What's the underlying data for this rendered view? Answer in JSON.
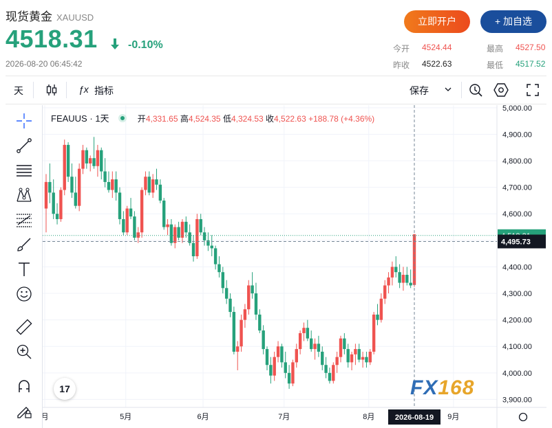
{
  "header": {
    "name": "现货黄金",
    "symbol": "XAUUSD",
    "price": "4518.31",
    "change_pct": "-0.10%",
    "timestamp": "2026-08-20 06:45:42",
    "open_account_label": "立即开户",
    "watchlist_label": "+ 加自选",
    "stats": {
      "open_label": "今开",
      "open_value": "4524.44",
      "high_label": "最高",
      "high_value": "4527.50",
      "prev_close_label": "昨收",
      "prev_close_value": "4522.63",
      "low_label": "最低",
      "low_value": "4517.52"
    },
    "colors": {
      "up": "#ef5350",
      "down": "#26a17b",
      "price_text": "#26a17b"
    }
  },
  "toolbar": {
    "interval_label": "天",
    "indicators_label": "指标",
    "save_label": "保存",
    "icons": [
      "candle-style-icon",
      "fx-indicator-icon",
      "chevron-down-icon",
      "alert-icon",
      "settings-hexagon-icon",
      "fullscreen-icon"
    ]
  },
  "left_tools": [
    "crosshair-icon",
    "trend-line-icon",
    "horizontal-lines-icon",
    "pattern-icon",
    "fib-levels-icon",
    "brush-icon",
    "text-icon",
    "emoji-icon",
    "ruler-icon",
    "zoom-icon",
    "magnet-icon",
    "lock-pencil-icon"
  ],
  "legend": {
    "symbol": "FEAUUS",
    "interval": "1天",
    "open_label": "开",
    "open": "4,331.65",
    "high_label": "高",
    "high": "4,524.35",
    "low_label": "低",
    "low": "4,324.53",
    "close_label": "收",
    "close": "4,522.63",
    "change": "+188.78 (+4.36%)"
  },
  "watermark": {
    "fx": "FX",
    "num": "168"
  },
  "tv_logo": "17",
  "chart_data": {
    "type": "candlestick",
    "y_ticks": [
      "5,000.00",
      "4,900.00",
      "4,800.00",
      "4,700.00",
      "4,600.00",
      "4,500.00",
      "4,400.00",
      "4,300.00",
      "4,200.00",
      "4,100.00",
      "4,000.00",
      "3,900.00"
    ],
    "ylim": [
      3870,
      5010
    ],
    "x_labels": [
      {
        "label": "月",
        "index": 0
      },
      {
        "label": "5月",
        "index": 22
      },
      {
        "label": "6月",
        "index": 43
      },
      {
        "label": "7月",
        "index": 65
      },
      {
        "label": "8月",
        "index": 88
      },
      {
        "label": "9月",
        "index": 111
      }
    ],
    "crosshair": {
      "date_label": "2026-08-19",
      "index": 100,
      "price": 4495.73,
      "price_label": "4,495.73"
    },
    "last_price": {
      "value": 4518.31,
      "label": "4,518.31"
    },
    "grid": true,
    "colors": {
      "up": "#ef5350",
      "down": "#26a17b"
    },
    "candles": [
      [
        4620,
        4750,
        4530,
        4720
      ],
      [
        4720,
        4790,
        4640,
        4680
      ],
      [
        4680,
        4730,
        4580,
        4600
      ],
      [
        4600,
        4640,
        4560,
        4580
      ],
      [
        4580,
        4700,
        4570,
        4690
      ],
      [
        4690,
        4880,
        4670,
        4860
      ],
      [
        4860,
        4870,
        4720,
        4740
      ],
      [
        4740,
        4790,
        4660,
        4680
      ],
      [
        4680,
        4740,
        4620,
        4630
      ],
      [
        4630,
        4790,
        4610,
        4770
      ],
      [
        4770,
        4860,
        4750,
        4840
      ],
      [
        4840,
        4850,
        4770,
        4790
      ],
      [
        4790,
        4820,
        4760,
        4810
      ],
      [
        4810,
        4890,
        4770,
        4780
      ],
      [
        4780,
        4860,
        4740,
        4840
      ],
      [
        4840,
        4850,
        4730,
        4760
      ],
      [
        4760,
        4810,
        4700,
        4720
      ],
      [
        4720,
        4760,
        4680,
        4690
      ],
      [
        4690,
        4760,
        4660,
        4730
      ],
      [
        4730,
        4760,
        4650,
        4680
      ],
      [
        4680,
        4700,
        4560,
        4580
      ],
      [
        4580,
        4610,
        4520,
        4530
      ],
      [
        4530,
        4630,
        4520,
        4620
      ],
      [
        4620,
        4660,
        4580,
        4590
      ],
      [
        4590,
        4610,
        4500,
        4510
      ],
      [
        4510,
        4550,
        4490,
        4530
      ],
      [
        4530,
        4700,
        4510,
        4690
      ],
      [
        4690,
        4760,
        4670,
        4740
      ],
      [
        4740,
        4760,
        4670,
        4680
      ],
      [
        4680,
        4750,
        4660,
        4730
      ],
      [
        4730,
        4770,
        4690,
        4710
      ],
      [
        4710,
        4730,
        4640,
        4650
      ],
      [
        4650,
        4660,
        4540,
        4550
      ],
      [
        4550,
        4580,
        4520,
        4560
      ],
      [
        4560,
        4580,
        4480,
        4490
      ],
      [
        4490,
        4560,
        4470,
        4550
      ],
      [
        4550,
        4570,
        4500,
        4510
      ],
      [
        4510,
        4580,
        4490,
        4570
      ],
      [
        4570,
        4590,
        4510,
        4530
      ],
      [
        4530,
        4560,
        4480,
        4490
      ],
      [
        4490,
        4520,
        4420,
        4440
      ],
      [
        4440,
        4600,
        4430,
        4580
      ],
      [
        4580,
        4600,
        4520,
        4530
      ],
      [
        4530,
        4550,
        4480,
        4500
      ],
      [
        4500,
        4530,
        4460,
        4480
      ],
      [
        4480,
        4520,
        4440,
        4470
      ],
      [
        4470,
        4480,
        4390,
        4410
      ],
      [
        4410,
        4440,
        4360,
        4380
      ],
      [
        4380,
        4400,
        4300,
        4320
      ],
      [
        4320,
        4350,
        4260,
        4280
      ],
      [
        4280,
        4300,
        4210,
        4230
      ],
      [
        4230,
        4250,
        4070,
        4080
      ],
      [
        4080,
        4120,
        4010,
        4100
      ],
      [
        4100,
        4220,
        4080,
        4200
      ],
      [
        4200,
        4260,
        4170,
        4240
      ],
      [
        4240,
        4350,
        4220,
        4330
      ],
      [
        4330,
        4380,
        4280,
        4300
      ],
      [
        4300,
        4340,
        4200,
        4220
      ],
      [
        4220,
        4240,
        4150,
        4160
      ],
      [
        4160,
        4180,
        4070,
        4090
      ],
      [
        4090,
        4100,
        4010,
        4030
      ],
      [
        4030,
        4060,
        3960,
        3990
      ],
      [
        3990,
        4080,
        3970,
        4060
      ],
      [
        4060,
        4120,
        4040,
        4100
      ],
      [
        4100,
        4110,
        4020,
        4040
      ],
      [
        4040,
        4080,
        3980,
        4000
      ],
      [
        4000,
        4030,
        3940,
        3960
      ],
      [
        3960,
        4050,
        3950,
        4040
      ],
      [
        4040,
        4110,
        4020,
        4090
      ],
      [
        4090,
        4160,
        4070,
        4150
      ],
      [
        4150,
        4190,
        4120,
        4170
      ],
      [
        4170,
        4200,
        4120,
        4130
      ],
      [
        4130,
        4160,
        4080,
        4090
      ],
      [
        4090,
        4130,
        4050,
        4110
      ],
      [
        4110,
        4140,
        4060,
        4080
      ],
      [
        4080,
        4100,
        4010,
        4030
      ],
      [
        4030,
        4060,
        3980,
        4000
      ],
      [
        4000,
        4020,
        3960,
        3970
      ],
      [
        3970,
        4040,
        3960,
        4030
      ],
      [
        4030,
        4080,
        4000,
        4060
      ],
      [
        4060,
        4140,
        4040,
        4130
      ],
      [
        4130,
        4150,
        4070,
        4090
      ],
      [
        4090,
        4110,
        4020,
        4040
      ],
      [
        4040,
        4080,
        4010,
        4070
      ],
      [
        4070,
        4110,
        4030,
        4090
      ],
      [
        4090,
        4110,
        4040,
        4050
      ],
      [
        4050,
        4080,
        4020,
        4060
      ],
      [
        4060,
        4080,
        4020,
        4040
      ],
      [
        4040,
        4090,
        4030,
        4080
      ],
      [
        4080,
        4230,
        4070,
        4220
      ],
      [
        4220,
        4260,
        4180,
        4200
      ],
      [
        4200,
        4300,
        4190,
        4280
      ],
      [
        4280,
        4350,
        4260,
        4330
      ],
      [
        4330,
        4380,
        4300,
        4360
      ],
      [
        4360,
        4420,
        4330,
        4400
      ],
      [
        4400,
        4440,
        4360,
        4380
      ],
      [
        4380,
        4410,
        4320,
        4340
      ],
      [
        4340,
        4400,
        4310,
        4370
      ],
      [
        4370,
        4400,
        4330,
        4340
      ],
      [
        4340,
        4390,
        4320,
        4330
      ],
      [
        4331.65,
        4524.35,
        4324.53,
        4522.63
      ]
    ]
  }
}
